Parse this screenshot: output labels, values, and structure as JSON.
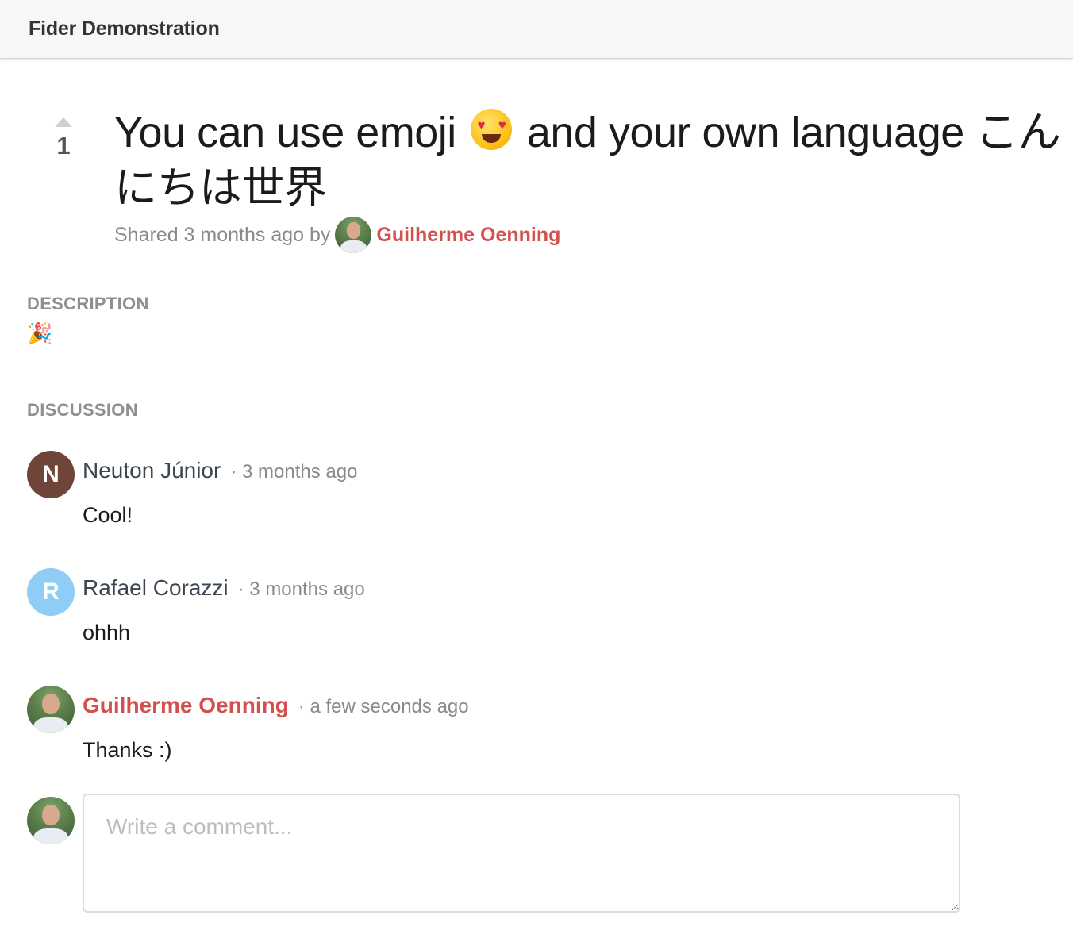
{
  "header": {
    "site_name": "Fider Demonstration"
  },
  "idea": {
    "votes": "1",
    "title_part1": "You can use emoji",
    "title_emoji": "heart-eyes-emoji",
    "title_part2": "and your own language こんにちは世界",
    "shared_prefix": "Shared 3 months ago by",
    "author": "Guilherme Oenning"
  },
  "description": {
    "label": "DESCRIPTION",
    "content": "🎉"
  },
  "discussion": {
    "label": "DISCUSSION",
    "comments": [
      {
        "author": "Neuton Júnior",
        "avatar_letter": "N",
        "avatar_color": "#6e4538",
        "time": "· 3 months ago",
        "text": "Cool!"
      },
      {
        "author": "Rafael Corazzi",
        "avatar_letter": "R",
        "avatar_color": "#8fcdf7",
        "time": "· 3 months ago",
        "text": "ohhh"
      },
      {
        "author": "Guilherme Oenning",
        "avatar_letter": "",
        "avatar_color": "",
        "time": "· a few seconds ago",
        "text": "Thanks :)"
      }
    ],
    "compose_placeholder": "Write a comment..."
  },
  "colors": {
    "staff_name": "#d2504d",
    "muted_text": "#8a8a8a"
  }
}
